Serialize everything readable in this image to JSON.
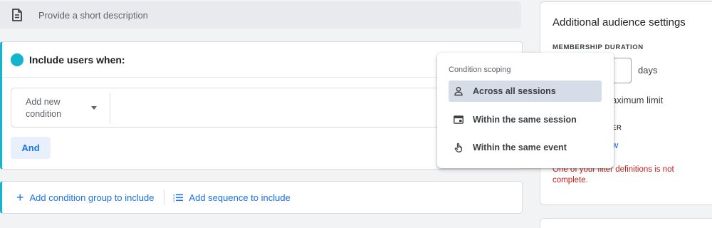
{
  "description": {
    "placeholder": "Provide a short description",
    "icon": "document-icon"
  },
  "include_card": {
    "title": "Include users when:",
    "accent_color": "#12b5cb",
    "condition_select_label": "Add new condition",
    "and_button": "And"
  },
  "add_bar": {
    "add_group_label": "Add condition group to include",
    "add_sequence_label": "Add sequence to include"
  },
  "side_panel": {
    "title": "Additional audience settings",
    "membership_heading": "MEMBERSHIP DURATION",
    "days_label": "days",
    "limit_text": "aximum limit",
    "partial_heading": "ER",
    "partial_link": "w",
    "error_text": "One of your filter definitions is not complete."
  },
  "scoping_menu": {
    "title": "Condition scoping",
    "items": [
      {
        "label": "Across all sessions",
        "icon": "person-icon",
        "selected": true
      },
      {
        "label": "Within the same session",
        "icon": "session-card-icon",
        "selected": false
      },
      {
        "label": "Within the same event",
        "icon": "touch-hand-icon",
        "selected": false
      }
    ]
  },
  "colors": {
    "accent_blue": "#1a73e8",
    "teal": "#12b5cb",
    "error_red": "#c5221f",
    "selected_bg": "#d7dde8"
  }
}
